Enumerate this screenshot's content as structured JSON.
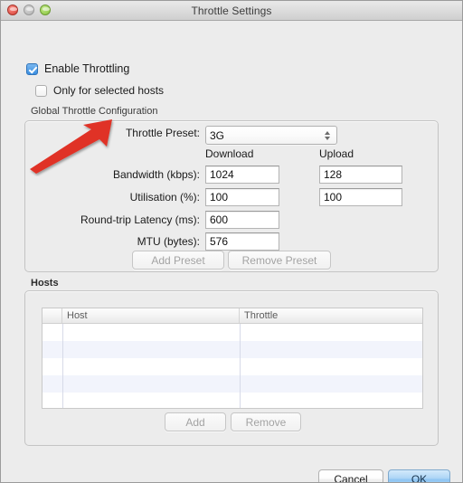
{
  "window": {
    "title": "Throttle Settings",
    "traffic_lights": [
      "close-button",
      "minimize-button",
      "zoom-button"
    ]
  },
  "checkboxes": {
    "enable_throttling": {
      "label": "Enable Throttling",
      "checked": true
    },
    "only_selected_hosts": {
      "label": "Only for selected hosts",
      "checked": false
    }
  },
  "global_group": {
    "label": "Global Throttle Configuration",
    "preset": {
      "label": "Throttle Preset:",
      "value": "3G"
    },
    "column_headers": {
      "download": "Download",
      "upload": "Upload"
    },
    "fields": [
      {
        "label": "Bandwidth (kbps):",
        "download": "1024",
        "upload": "128"
      },
      {
        "label": "Utilisation (%):",
        "download": "100",
        "upload": "100"
      },
      {
        "label": "Round-trip Latency (ms):",
        "download": "600",
        "upload": null
      },
      {
        "label": "MTU (bytes):",
        "download": "576",
        "upload": null
      }
    ],
    "buttons": {
      "add_preset": "Add Preset",
      "remove_preset": "Remove Preset"
    }
  },
  "hosts_group": {
    "label": "Hosts",
    "table": {
      "columns": [
        "Host",
        "Throttle"
      ],
      "rows": []
    },
    "buttons": {
      "add": "Add",
      "remove": "Remove"
    }
  },
  "footer": {
    "cancel": "Cancel",
    "ok": "OK"
  },
  "annotation": {
    "arrow_color": "#e03126",
    "points_at": "Throttle Preset:"
  }
}
